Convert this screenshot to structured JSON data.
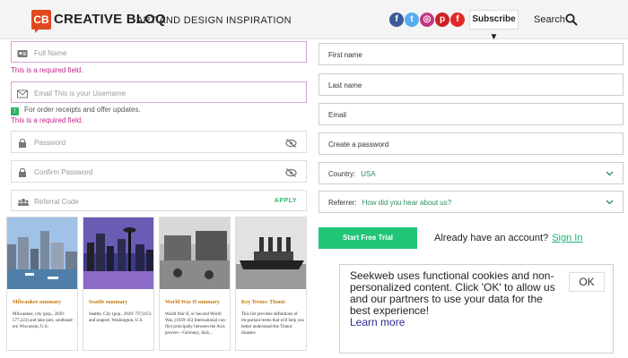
{
  "header": {
    "logo_mark": "CB",
    "logo_text": "CREATIVE BLOQ",
    "tagline": "ART AND DESIGN INSPIRATION",
    "social_icons": [
      "facebook-icon",
      "twitter-icon",
      "instagram-icon",
      "pinterest-icon",
      "flipboard-icon"
    ],
    "subscribe_label": "Subscribe ▼",
    "search_label": "Search"
  },
  "left_form": {
    "full_name_placeholder": "Full Name",
    "full_name_error": "This is a required field.",
    "email_placeholder": "Email   This is your Username",
    "email_note": "For order receipts and offer updates.",
    "email_error": "This is a required field.",
    "password_placeholder": "Password",
    "confirm_password_placeholder": "Confirm Password",
    "referral_placeholder": "Referral Code",
    "apply_label": "APPLY"
  },
  "cards": [
    {
      "title": "Milwaukee summary",
      "desc": "Milwaukee, city (pop., 2020: 577,222) and lake port, southeast-ern Wisconsin, U.S."
    },
    {
      "title": "Seattle summary",
      "desc": "Seattle, City (pop., 2020: 737,015) and seaport, Washington, U.S."
    },
    {
      "title": "World War II summary",
      "desc": "World War II, or Second World War, (1939–45) International con-flict principally between the Axis powers—Germany, Italy..."
    },
    {
      "title": "Key Terms: Titanic",
      "desc": "This list provides definitions of im-portant terms that will help you better understand the Titanic disaster."
    }
  ],
  "right_form": {
    "first_name_label": "First name",
    "last_name_label": "Last name",
    "email_label": "Email",
    "password_label": "Create a password",
    "country_label": "Country:",
    "country_value": "USA",
    "referrer_label": "Referrer:",
    "referrer_value": "How did you hear about us?",
    "trial_button": "Start Free Trial",
    "already_text": "Already have an account?",
    "signin_link": "Sign In"
  },
  "cookie": {
    "message": "Seekweb uses functional cookies and non-personalized content. Click 'OK' to allow us and our partners to use your data for the best experience!",
    "learn_more": "Learn more",
    "ok_label": "OK"
  },
  "colors": {
    "brand": "#e0491f",
    "accent_green": "#22c578",
    "error_pink": "#c2248b"
  }
}
